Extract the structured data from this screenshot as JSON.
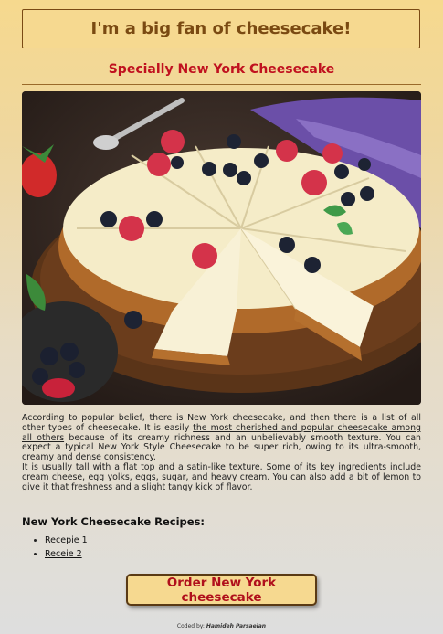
{
  "header": {
    "title": "I'm a big fan of cheesecake!"
  },
  "main": {
    "subtitle": "Specially New York Cheesecake",
    "image": {
      "description": "cheesecake-photo"
    },
    "paragraph1": {
      "before_link": "According to popular belief, there is New York cheesecake, and then there is a list of all other types of cheesecake. It is easily ",
      "link_text": "the most cherished and popular cheesecake among all others",
      "after_link": " because of its creamy richness and an unbelievably smooth texture. You can expect a typical New York Style Cheesecake to be super rich, owing to its ultra-smooth, creamy and dense consistency."
    },
    "paragraph2": "It is usually tall with a flat top and a satin-like texture. Some of its key ingredients include cream cheese, egg yolks, eggs, sugar, and heavy cream. You can also add a bit of lemon to give it that freshness and a slight tangy kick of flavor.",
    "recipes": {
      "heading": "New York Cheesecake Recipes:",
      "items": [
        "Recepie 1",
        "Receie 2"
      ]
    },
    "order_button": "Order New York cheesecake"
  },
  "footer": {
    "prefix": "Coded by: ",
    "author": "Hamideh Parsaeian"
  },
  "colors": {
    "accent": "#c0111f",
    "title_text": "#7a4a12",
    "box_bg": "#f6d990"
  }
}
